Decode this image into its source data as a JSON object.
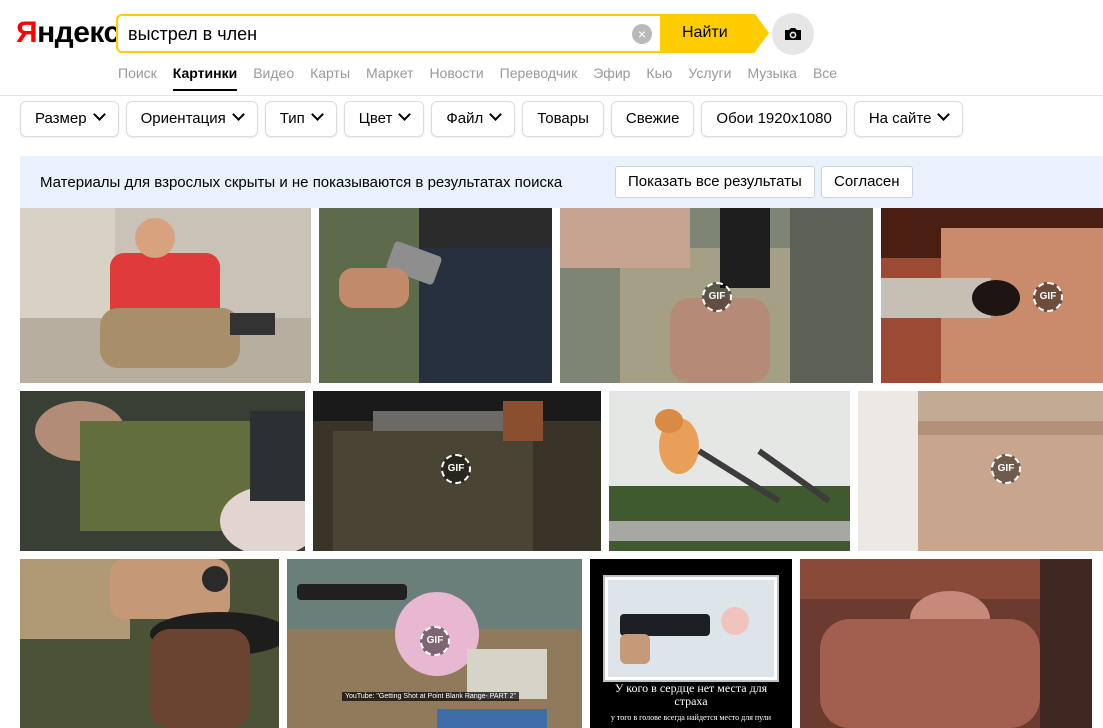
{
  "header": {
    "logo_first": "Я",
    "logo_rest": "ндекс",
    "search": {
      "value": "выстрел в член",
      "clear_glyph": "×"
    },
    "find_label": "Найти"
  },
  "services": [
    {
      "label": "Поиск"
    },
    {
      "label": "Картинки",
      "active": true
    },
    {
      "label": "Видео"
    },
    {
      "label": "Карты"
    },
    {
      "label": "Маркет"
    },
    {
      "label": "Новости"
    },
    {
      "label": "Переводчик"
    },
    {
      "label": "Эфир"
    },
    {
      "label": "Кью"
    },
    {
      "label": "Услуги"
    },
    {
      "label": "Музыка"
    },
    {
      "label": "Все"
    }
  ],
  "filters": [
    {
      "label": "Размер",
      "dropdown": true
    },
    {
      "label": "Ориентация",
      "dropdown": true
    },
    {
      "label": "Тип",
      "dropdown": true
    },
    {
      "label": "Цвет",
      "dropdown": true
    },
    {
      "label": "Файл",
      "dropdown": true
    },
    {
      "label": "Товары",
      "dropdown": false
    },
    {
      "label": "Свежие",
      "dropdown": false
    },
    {
      "label": "Обои 1920x1080",
      "dropdown": false
    },
    {
      "label": "На сайте",
      "dropdown": true
    }
  ],
  "adult_notice": {
    "message": "Материалы для взрослых скрыты и не показываются в результатах поиска",
    "show_all_label": "Показать все результаты",
    "agree_label": "Согласен"
  },
  "gif_badge": "GIF",
  "image_texts": {
    "youtube_caption": "YouTube: \"Getting Shot at Point Blank Range- PART 2\"",
    "demotivator_title": "У кого в сердце нет места для страха",
    "demotivator_subtitle": "у того в голове всегда найдется место для пули"
  },
  "colors": {
    "accent": "#ffcc00",
    "logo_red": "#ff0000",
    "notice_bg": "#e9f1fc"
  }
}
